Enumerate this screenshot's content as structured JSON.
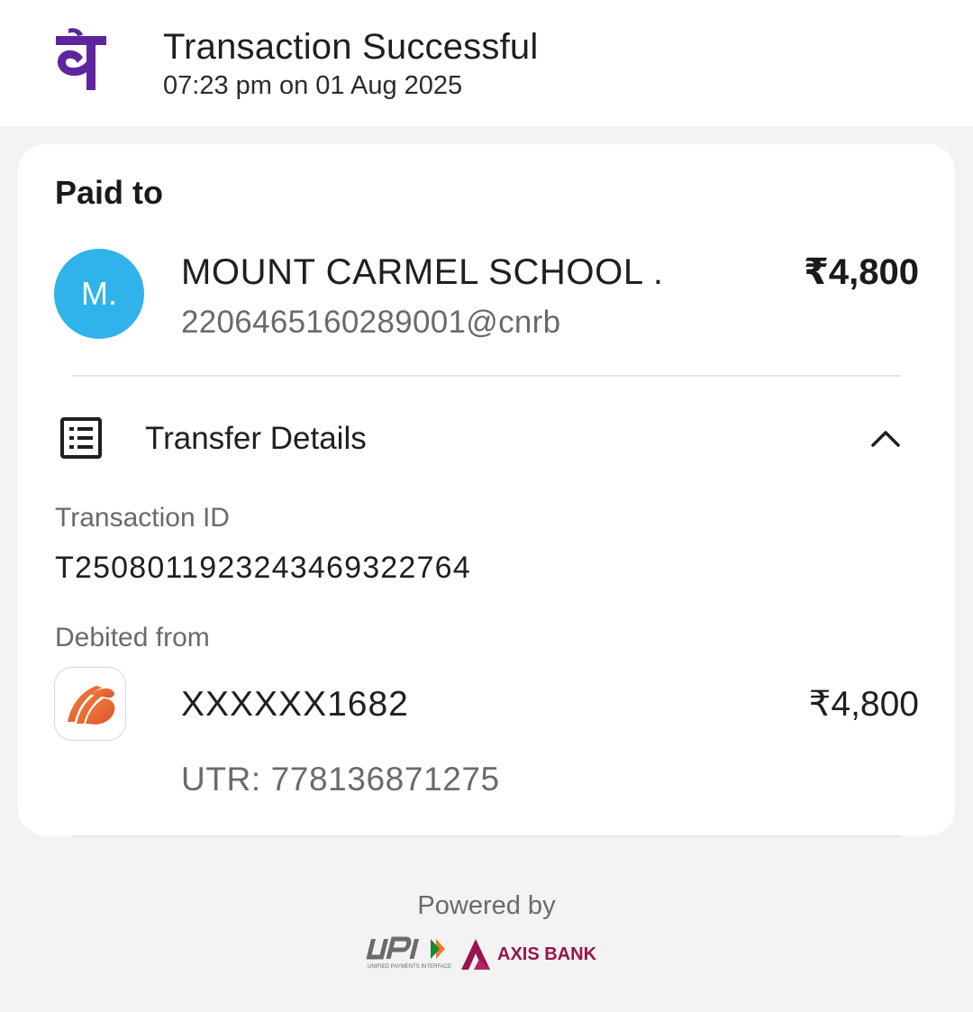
{
  "header": {
    "title": "Transaction Successful",
    "timestamp": "07:23 pm on 01 Aug 2025",
    "logo_glyph": "पे",
    "brand_color": "#5f259f"
  },
  "paid_to": {
    "label": "Paid to",
    "avatar_initial": "M.",
    "avatar_color": "#2fb3ea",
    "payee_name": "MOUNT CARMEL SCHOOL .",
    "payee_vpa": "220646516028900​1@cnrb",
    "amount": "₹4,800"
  },
  "transfer_details": {
    "label": "Transfer Details",
    "icon": "document-list-icon",
    "expand_icon": "chevron-up-icon",
    "transaction_id_label": "Transaction ID",
    "transaction_id": "T2508011923243469322764",
    "debited_from_label": "Debited from",
    "account_number": "XXXXXX1682",
    "debited_amount": "₹4,800",
    "utr": "UTR: 778136871275",
    "bank_icon": "bank-of-baroda-logo"
  },
  "footer": {
    "powered_by": "Powered by",
    "upi_tagline": "UNIFIED PAYMENTS INTERFACE",
    "partner_bank": "AXIS BANK"
  }
}
